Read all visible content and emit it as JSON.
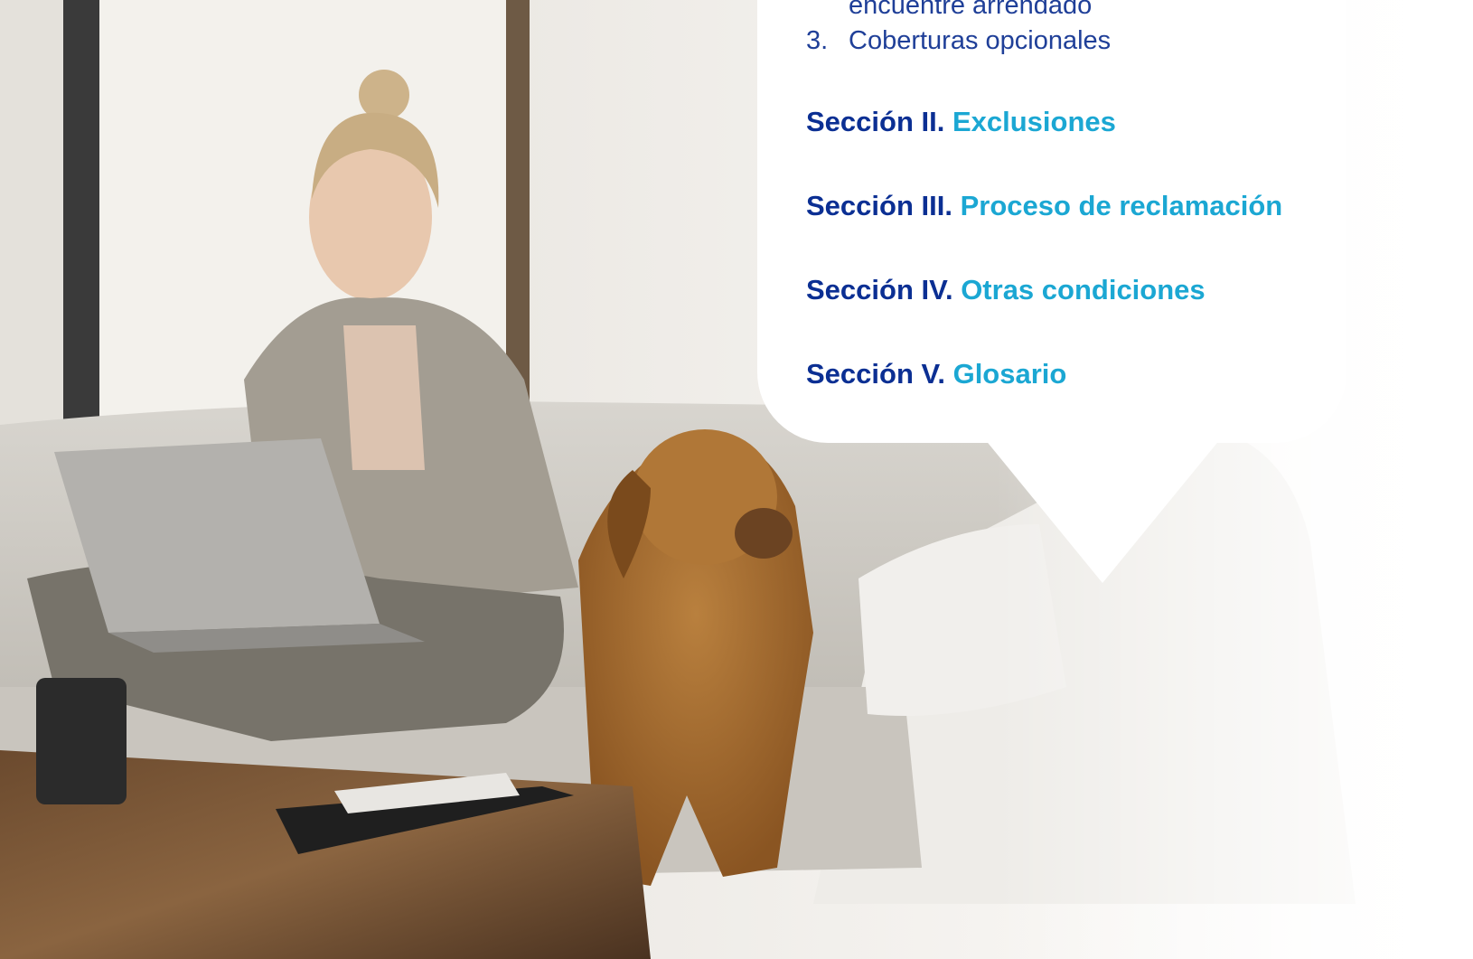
{
  "document": {
    "continued_item": "encuentre arrendado",
    "list_item_3": {
      "number": "3.",
      "text": "Coberturas opcionales"
    },
    "sections": [
      {
        "label": "Sección II.",
        "title": "Exclusiones"
      },
      {
        "label": "Sección III.",
        "title": "Proceso de reclamación"
      },
      {
        "label": "Sección IV.",
        "title": "Otras condiciones"
      },
      {
        "label": "Sección V.",
        "title": "Glosario"
      }
    ]
  },
  "colors": {
    "section_label": "#0b2f93",
    "section_title": "#1ba7d3",
    "list_text": "#1f3f98",
    "bubble_fill": "#ffffff"
  }
}
